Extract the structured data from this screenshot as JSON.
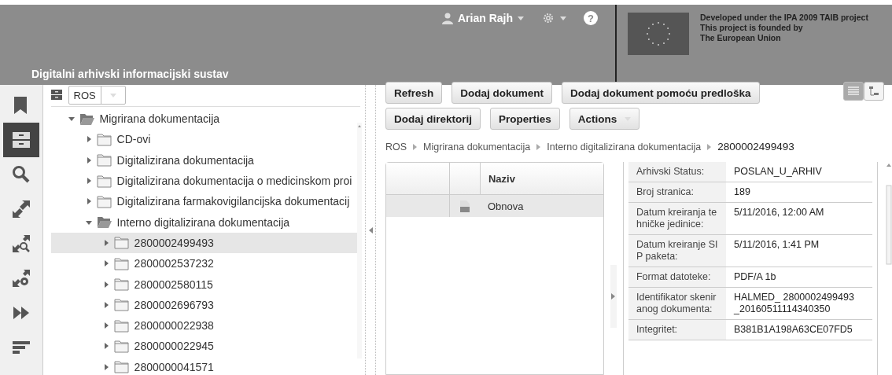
{
  "header": {
    "title": "Digitalni arhivski informacijski sustav",
    "user": "Arian Rajh",
    "help": "?",
    "eu_text": [
      "Developed under the IPA 2009 TAIB project",
      "This project is founded by",
      "The European Union"
    ]
  },
  "rail": [
    {
      "kind": "bookmark",
      "selected": false
    },
    {
      "kind": "archive",
      "selected": true
    },
    {
      "kind": "search",
      "selected": false
    },
    {
      "kind": "export",
      "selected": false
    },
    {
      "kind": "export-search",
      "selected": false
    },
    {
      "kind": "export-settings",
      "selected": false
    },
    {
      "kind": "forward",
      "selected": false
    },
    {
      "kind": "sort",
      "selected": false
    }
  ],
  "repository": {
    "value": "ROS"
  },
  "tree": [
    {
      "label": "Migrirana dokumentacija",
      "expanded": true,
      "selected": false,
      "children": [
        {
          "label": "CD-ovi",
          "expanded": false,
          "selected": false
        },
        {
          "label": "Digitalizirana dokumentacija",
          "expanded": false,
          "selected": false
        },
        {
          "label": "Digitalizirana dokumentacija o medicinskom proi",
          "expanded": false,
          "selected": false
        },
        {
          "label": "Digitalizirana farmakovigilancijska dokumentacij",
          "expanded": false,
          "selected": false
        },
        {
          "label": "Interno digitalizirana dokumentacija",
          "expanded": true,
          "selected": false,
          "children": [
            {
              "label": "2800002499493",
              "expanded": false,
              "selected": true
            },
            {
              "label": "2800002537232",
              "expanded": false,
              "selected": false
            },
            {
              "label": "2800002580115",
              "expanded": false,
              "selected": false
            },
            {
              "label": "2800002696793",
              "expanded": false,
              "selected": false
            },
            {
              "label": "2800000022938",
              "expanded": false,
              "selected": false
            },
            {
              "label": "2800000022945",
              "expanded": false,
              "selected": false
            },
            {
              "label": "2800000041571",
              "expanded": false,
              "selected": false
            }
          ]
        }
      ]
    }
  ],
  "toolbar": [
    [
      {
        "label": "Refresh",
        "kind": "plain"
      },
      {
        "label": "Dodaj dokument",
        "kind": "plain"
      },
      {
        "label": "Dodaj dokument pomoću predloška",
        "kind": "plain"
      }
    ],
    [
      {
        "label": "Dodaj direktorij",
        "kind": "plain"
      },
      {
        "label": "Properties",
        "kind": "plain"
      },
      {
        "label": "Actions",
        "kind": "dropdown"
      }
    ]
  ],
  "view_toggle": [
    {
      "kind": "list",
      "selected": true
    },
    {
      "kind": "tree",
      "selected": false
    }
  ],
  "breadcrumb": [
    "ROS",
    "Migrirana dokumentacija",
    "Interno digitalizirana dokumentacija",
    "2800002499493"
  ],
  "table": {
    "columns": [
      "Naziv"
    ],
    "rows": [
      {
        "name": "Obnova",
        "kind": "pdf",
        "selected": true
      }
    ]
  },
  "details": [
    {
      "label": "Arhivski Status:",
      "value": "POSLAN_U_ARHIV"
    },
    {
      "label": "Broj stranica:",
      "value": "189"
    },
    {
      "label": "Datum kreiranja tehničke jedinice:",
      "value": "5/11/2016, 12:00 AM"
    },
    {
      "label": "Datum kreiranje SIP paketa:",
      "value": "5/11/2016, 1:41 PM"
    },
    {
      "label": "Format datoteke:",
      "value": "PDF/A 1b"
    },
    {
      "label": "Identifikator skeniranog dokumenta:",
      "value": "HALMED_ 2800002499493 _20160511114340350"
    },
    {
      "label": "Integritet:",
      "value": "B381B1A198A63CE07FD5"
    }
  ]
}
